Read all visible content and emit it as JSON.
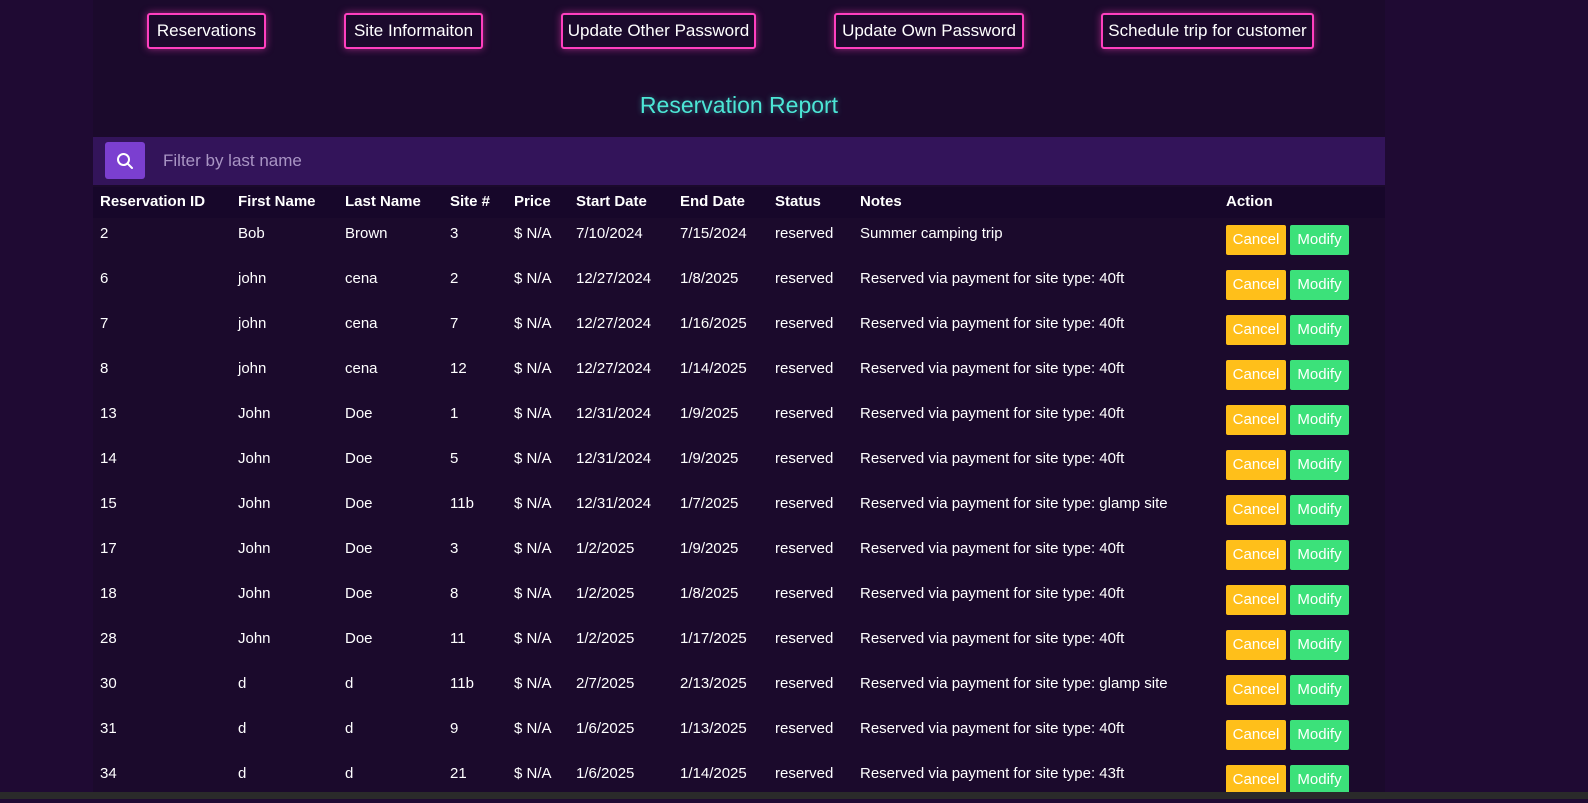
{
  "nav": {
    "items": [
      {
        "label": "Reservations"
      },
      {
        "label": "Site Informaiton"
      },
      {
        "label": "Update Other Password"
      },
      {
        "label": "Update Own Password"
      },
      {
        "label": "Schedule trip for customer"
      }
    ]
  },
  "page": {
    "title": "Reservation Report"
  },
  "filter": {
    "placeholder": "Filter by last name",
    "value": "",
    "icon": "search-icon"
  },
  "table": {
    "headers": [
      "Reservation ID",
      "First Name",
      "Last Name",
      "Site #",
      "Price",
      "Start Date",
      "End Date",
      "Status",
      "Notes",
      "Action"
    ],
    "cancel_label": "Cancel",
    "modify_label": "Modify",
    "rows": [
      {
        "id": "2",
        "first": "Bob",
        "last": "Brown",
        "site": "3",
        "price": "$ N/A",
        "start": "7/10/2024",
        "end": "7/15/2024",
        "status": "reserved",
        "notes": "Summer camping trip"
      },
      {
        "id": "6",
        "first": "john",
        "last": "cena",
        "site": "2",
        "price": "$ N/A",
        "start": "12/27/2024",
        "end": "1/8/2025",
        "status": "reserved",
        "notes": "Reserved via payment for site type: 40ft"
      },
      {
        "id": "7",
        "first": "john",
        "last": "cena",
        "site": "7",
        "price": "$ N/A",
        "start": "12/27/2024",
        "end": "1/16/2025",
        "status": "reserved",
        "notes": "Reserved via payment for site type: 40ft"
      },
      {
        "id": "8",
        "first": "john",
        "last": "cena",
        "site": "12",
        "price": "$ N/A",
        "start": "12/27/2024",
        "end": "1/14/2025",
        "status": "reserved",
        "notes": "Reserved via payment for site type: 40ft"
      },
      {
        "id": "13",
        "first": "John",
        "last": "Doe",
        "site": "1",
        "price": "$ N/A",
        "start": "12/31/2024",
        "end": "1/9/2025",
        "status": "reserved",
        "notes": "Reserved via payment for site type: 40ft"
      },
      {
        "id": "14",
        "first": "John",
        "last": "Doe",
        "site": "5",
        "price": "$ N/A",
        "start": "12/31/2024",
        "end": "1/9/2025",
        "status": "reserved",
        "notes": "Reserved via payment for site type: 40ft"
      },
      {
        "id": "15",
        "first": "John",
        "last": "Doe",
        "site": "11b",
        "price": "$ N/A",
        "start": "12/31/2024",
        "end": "1/7/2025",
        "status": "reserved",
        "notes": "Reserved via payment for site type: glamp site"
      },
      {
        "id": "17",
        "first": "John",
        "last": "Doe",
        "site": "3",
        "price": "$ N/A",
        "start": "1/2/2025",
        "end": "1/9/2025",
        "status": "reserved",
        "notes": "Reserved via payment for site type: 40ft"
      },
      {
        "id": "18",
        "first": "John",
        "last": "Doe",
        "site": "8",
        "price": "$ N/A",
        "start": "1/2/2025",
        "end": "1/8/2025",
        "status": "reserved",
        "notes": "Reserved via payment for site type: 40ft"
      },
      {
        "id": "28",
        "first": "John",
        "last": "Doe",
        "site": "11",
        "price": "$ N/A",
        "start": "1/2/2025",
        "end": "1/17/2025",
        "status": "reserved",
        "notes": "Reserved via payment for site type: 40ft"
      },
      {
        "id": "30",
        "first": "d",
        "last": "d",
        "site": "11b",
        "price": "$ N/A",
        "start": "2/7/2025",
        "end": "2/13/2025",
        "status": "reserved",
        "notes": "Reserved via payment for site type: glamp site"
      },
      {
        "id": "31",
        "first": "d",
        "last": "d",
        "site": "9",
        "price": "$ N/A",
        "start": "1/6/2025",
        "end": "1/13/2025",
        "status": "reserved",
        "notes": "Reserved via payment for site type: 40ft"
      },
      {
        "id": "34",
        "first": "d",
        "last": "d",
        "site": "21",
        "price": "$ N/A",
        "start": "1/6/2025",
        "end": "1/14/2025",
        "status": "reserved",
        "notes": "Reserved via payment for site type: 43ft"
      }
    ]
  },
  "colors": {
    "accent_border": "#ff3fbf",
    "title": "#4ce6d6",
    "cancel": "#ffbf1a",
    "modify": "#3ce17a",
    "search_button": "#7b3fd0"
  }
}
